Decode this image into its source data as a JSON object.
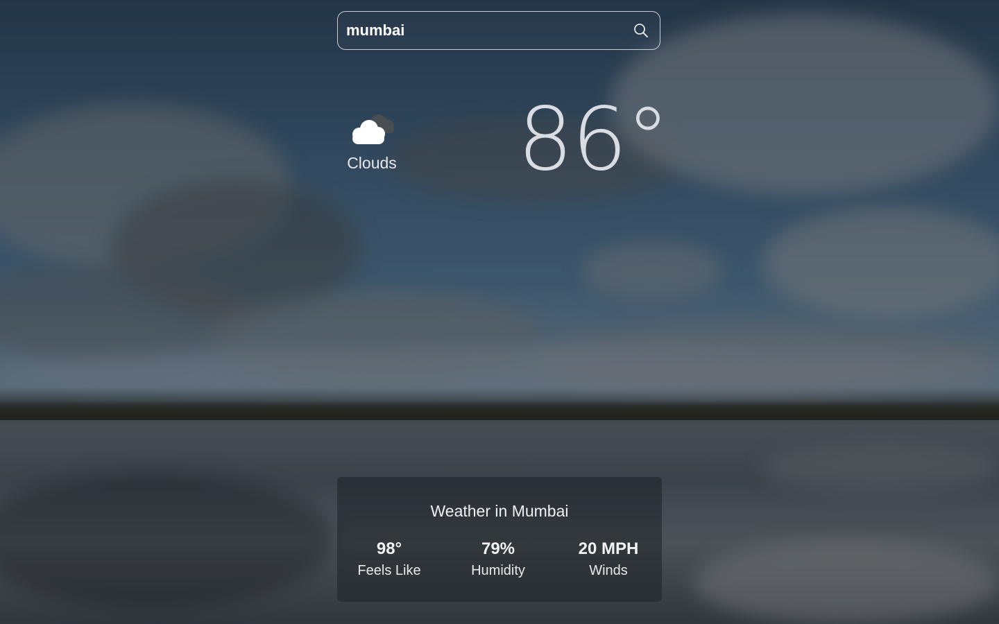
{
  "search": {
    "value": "mumbai",
    "icon": "search-icon"
  },
  "current": {
    "condition_label": "Clouds",
    "condition_icon": "cloud-icon",
    "temperature": "86°"
  },
  "details": {
    "title": "Weather in Mumbai",
    "stats": [
      {
        "value": "98°",
        "label": "Feels Like"
      },
      {
        "value": "79%",
        "label": "Humidity"
      },
      {
        "value": "20 MPH",
        "label": "Winds"
      }
    ]
  }
}
